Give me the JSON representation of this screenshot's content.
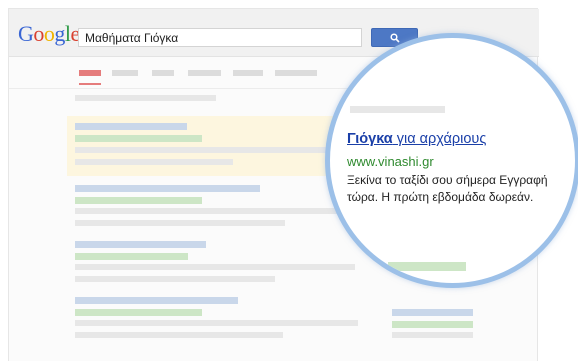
{
  "search": {
    "logo_letters": [
      {
        "ch": "G",
        "color": "#3a66d4"
      },
      {
        "ch": "o",
        "color": "#d9402f"
      },
      {
        "ch": "o",
        "color": "#f0b400"
      },
      {
        "ch": "g",
        "color": "#3a66d4"
      },
      {
        "ch": "l",
        "color": "#2f9a47"
      },
      {
        "ch": "e",
        "color": "#d9402f"
      }
    ],
    "query": "Μαθήματα Γιόγκα",
    "button_icon": "search-icon"
  },
  "ad": {
    "title_bold": "Γιόγκα",
    "title_rest": " για αρχάριους",
    "url": "www.vinashi.gr",
    "description": "Ξεκίνα το ταξίδι σου σήμερα Εγγραφή τώρα. Η πρώτη εβδομάδα δωρεάν."
  },
  "colors": {
    "accent_blue": "#4d78c5",
    "lens_border": "#9cc0e8",
    "ad_highlight": "#fdf6df",
    "link_blue": "#1a3fa8",
    "url_green": "#2f8a2f"
  }
}
